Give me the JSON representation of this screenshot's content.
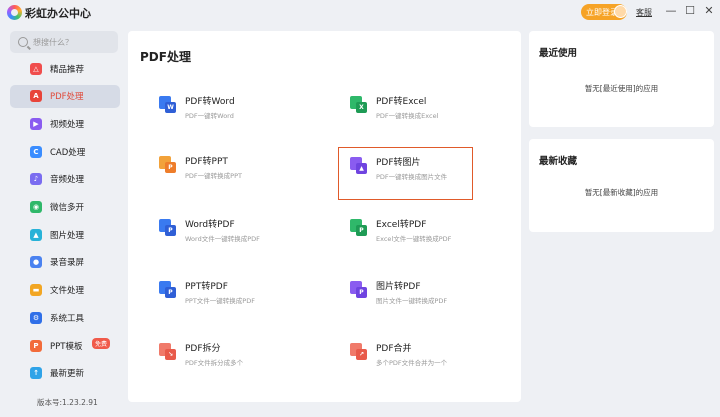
{
  "app": {
    "title": "彩虹办公中心",
    "login_label": "立即登录",
    "feedback_label": "客服",
    "min_glyph": "—",
    "max_glyph": "☐",
    "close_glyph": "✕"
  },
  "sidebar": {
    "search_placeholder": "想搜什么？",
    "items": [
      {
        "label": "精品推荐",
        "icon": "recommend-icon",
        "color": "#f04d4d",
        "glyph": "△"
      },
      {
        "label": "PDF处理",
        "icon": "pdf-icon",
        "color": "#e8443a",
        "glyph": "A",
        "active": true
      },
      {
        "label": "视频处理",
        "icon": "video-icon",
        "color": "#8a5cf0",
        "glyph": "▶"
      },
      {
        "label": "CAD处理",
        "icon": "cad-icon",
        "color": "#3a8dff",
        "glyph": "C"
      },
      {
        "label": "音频处理",
        "icon": "audio-icon",
        "color": "#7a6cf0",
        "glyph": "♪"
      },
      {
        "label": "微信多开",
        "icon": "wechat-icon",
        "color": "#2fb86a",
        "glyph": "◉"
      },
      {
        "label": "图片处理",
        "icon": "image-icon",
        "color": "#27b2d8",
        "glyph": "▲"
      },
      {
        "label": "录音录屏",
        "icon": "record-icon",
        "color": "#4a82f0",
        "glyph": "●"
      },
      {
        "label": "文件处理",
        "icon": "file-icon",
        "color": "#f2a623",
        "glyph": "▬"
      },
      {
        "label": "系统工具",
        "icon": "system-icon",
        "color": "#2f6fe8",
        "glyph": "⚙"
      },
      {
        "label": "PPT模板",
        "icon": "ppt-icon",
        "color": "#f26b3a",
        "glyph": "P",
        "badge": "免费"
      },
      {
        "label": "最新更新",
        "icon": "update-icon",
        "color": "#2fa3e8",
        "glyph": "↑"
      }
    ],
    "version": "版本号:1.23.2.91"
  },
  "main": {
    "title": "PDF处理",
    "tools": [
      {
        "name": "PDF转Word",
        "desc": "PDF一键转Word",
        "icon": "pdf-to-word-icon",
        "back": "#3a7af0",
        "front": "#2f5fd6",
        "glyph": "W"
      },
      {
        "name": "PDF转Excel",
        "desc": "PDF一键转换成Excel",
        "icon": "pdf-to-excel-icon",
        "back": "#2fb86a",
        "front": "#1e9b55",
        "glyph": "X"
      },
      {
        "name": "PDF转PPT",
        "desc": "PDF一键转换成PPT",
        "icon": "pdf-to-ppt-icon",
        "back": "#f2a23a",
        "front": "#ee7d2a",
        "glyph": "P"
      },
      {
        "name": "PDF转图片",
        "desc": "PDF一键转换成图片文件",
        "icon": "pdf-to-image-icon",
        "back": "#8a5cf0",
        "front": "#6f44e0",
        "glyph": "▲",
        "highlight": true
      },
      {
        "name": "Word转PDF",
        "desc": "Word文件一键转换成PDF",
        "icon": "word-to-pdf-icon",
        "back": "#3a7af0",
        "front": "#2f5fd6",
        "glyph": "P"
      },
      {
        "name": "Excel转PDF",
        "desc": "Excel文件一键转换成PDF",
        "icon": "excel-to-pdf-icon",
        "back": "#2fb86a",
        "front": "#1e9b55",
        "glyph": "P"
      },
      {
        "name": "PPT转PDF",
        "desc": "PPT文件一键转换成PDF",
        "icon": "ppt-to-pdf-icon",
        "back": "#3a7af0",
        "front": "#2f5fd6",
        "glyph": "P"
      },
      {
        "name": "图片转PDF",
        "desc": "图片文件一键转换成PDF",
        "icon": "image-to-pdf-icon",
        "back": "#8a5cf0",
        "front": "#6f44e0",
        "glyph": "P"
      },
      {
        "name": "PDF拆分",
        "desc": "PDF文件拆分成多个",
        "icon": "pdf-split-icon",
        "back": "#f07a6a",
        "front": "#e85a4a",
        "glyph": "↘"
      },
      {
        "name": "PDF合并",
        "desc": "多个PDF文件合并为一个",
        "icon": "pdf-merge-icon",
        "back": "#f07a6a",
        "front": "#e85a4a",
        "glyph": "↗"
      }
    ]
  },
  "recent": {
    "title": "最近使用",
    "empty": "暂无[最近使用]的应用"
  },
  "favorites": {
    "title": "最新收藏",
    "empty": "暂无[最新收藏]的应用"
  }
}
